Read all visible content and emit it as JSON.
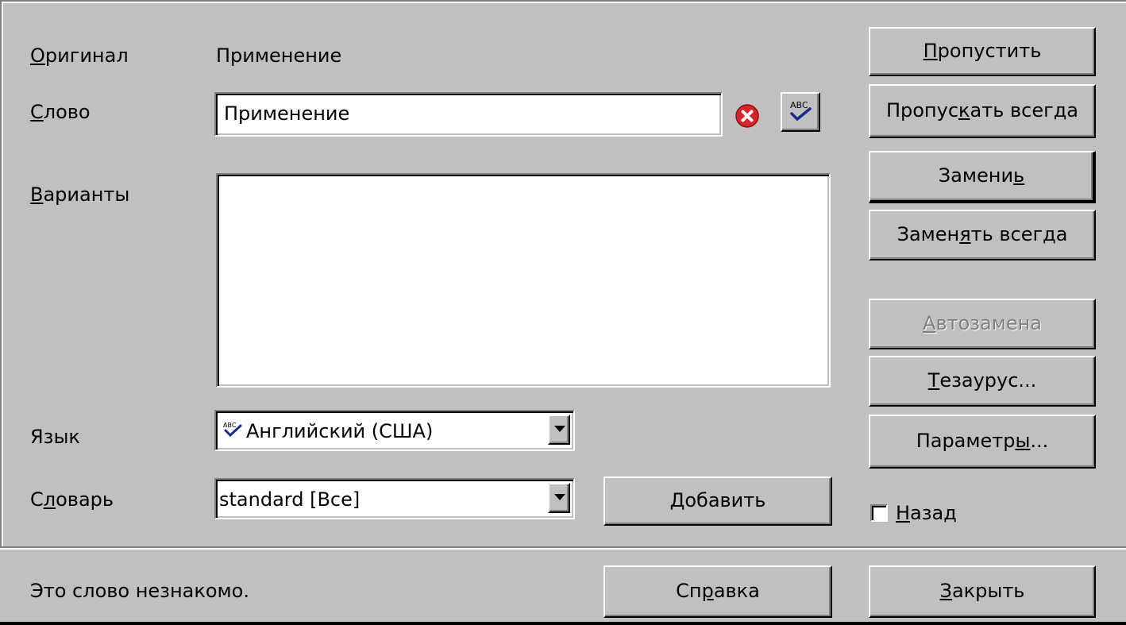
{
  "colors": {
    "face": "#c0c0c0",
    "error_icon": "#d9232b",
    "check_blue": "#1b2a8c"
  },
  "labels": {
    "original_pre": "",
    "original_u": "О",
    "original_post": "ригинал",
    "word_pre": "",
    "word_u": "С",
    "word_post": "лово",
    "variants_pre": "",
    "variants_u": "В",
    "variants_post": "арианты",
    "language": "Язык",
    "dictionary_pre": "С",
    "dictionary_u": "л",
    "dictionary_post": "оварь"
  },
  "original_value": "Применение",
  "word_field": {
    "value": "Применение"
  },
  "language_select": {
    "icon": "abc-spellcheck-icon",
    "value": "Английский (США)"
  },
  "dictionary_select": {
    "value": "standard [Все]"
  },
  "buttons": {
    "skip": {
      "pre": "",
      "u": "П",
      "post": "ропустить"
    },
    "skip_all": {
      "pre": "Пропус",
      "u": "к",
      "post": "ать всегда"
    },
    "replace": {
      "pre": "Замени",
      "u": "ь",
      "post": ""
    },
    "replace_all": {
      "pre": "Замен",
      "u": "я",
      "post": "ть всегда"
    },
    "autocorrect": {
      "pre": "",
      "u": "А",
      "post": "втозамена"
    },
    "thesaurus": {
      "pre": "",
      "u": "Т",
      "post": "езаурус..."
    },
    "options": {
      "pre": "Параметр",
      "u": "ы",
      "post": "..."
    },
    "add": {
      "pre": "",
      "u": "Д",
      "post": "обавить"
    },
    "help": {
      "pre": "Сп",
      "u": "р",
      "post": "авка"
    },
    "close": {
      "pre": "",
      "u": "З",
      "post": "акрыть"
    }
  },
  "back_checkbox": {
    "pre": "",
    "u": "Н",
    "post": "азад",
    "checked": false
  },
  "status_text": "Это слово незнакомо.",
  "icons": {
    "error": "error-x-icon",
    "spellcheck": "abc-spellcheck-icon"
  }
}
